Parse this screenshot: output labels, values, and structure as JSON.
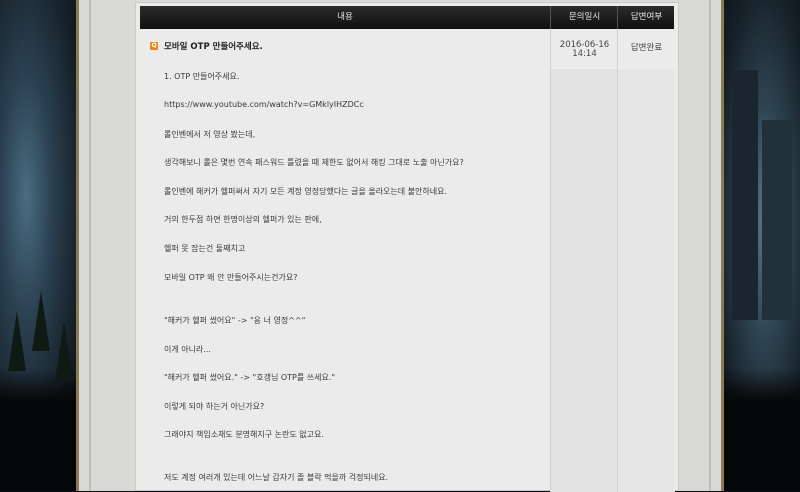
{
  "table": {
    "headers": {
      "content": "내용",
      "date": "문의일시",
      "status": "답변여부"
    }
  },
  "post": {
    "icon": "Q",
    "title": "모바일 OTP 만들어주세요.",
    "date_line1": "2016-06-16",
    "date_line2": "14:14",
    "status": "답변완료",
    "lines": [
      "1. OTP 만들어주세요.",
      "https://www.youtube.com/watch?v=GMklyIHZDCc",
      "롤인벤에서 저 영상 봤는데,",
      "생각해보니 롤은 몇번 연속 패스워드 틀렸을 때 제한도 없어서 해킹 그대로 노출 아닌가요?",
      "롤인벤에 해커가 헬퍼써서 자기 모든 계정 영정당했다는 글을 올라오는데 불안하네요.",
      "거의 한두점 하면 한명이상의 헬퍼가 있는 판에,",
      "헬퍼 못 잡는건 둘째치고",
      "모바일 OTP 왜 안 만들어주시는건가요?",
      "\"해커가 헬퍼 썼어요\" -> \"응 너 영정^^\"",
      "이게 아니라...",
      "\"해커가 헬퍼 썼어요.\" -> \"호갱님 OTP를 쓰세요.\"",
      "이렇게 되야 하는거 아닌가요?",
      "그래야지 책임소재도 분명해지구 논란도 없고요.",
      "저도 계정 여러개 있는데 어느날 갑자기 졸 블락 먹을까 걱정되네요."
    ]
  }
}
